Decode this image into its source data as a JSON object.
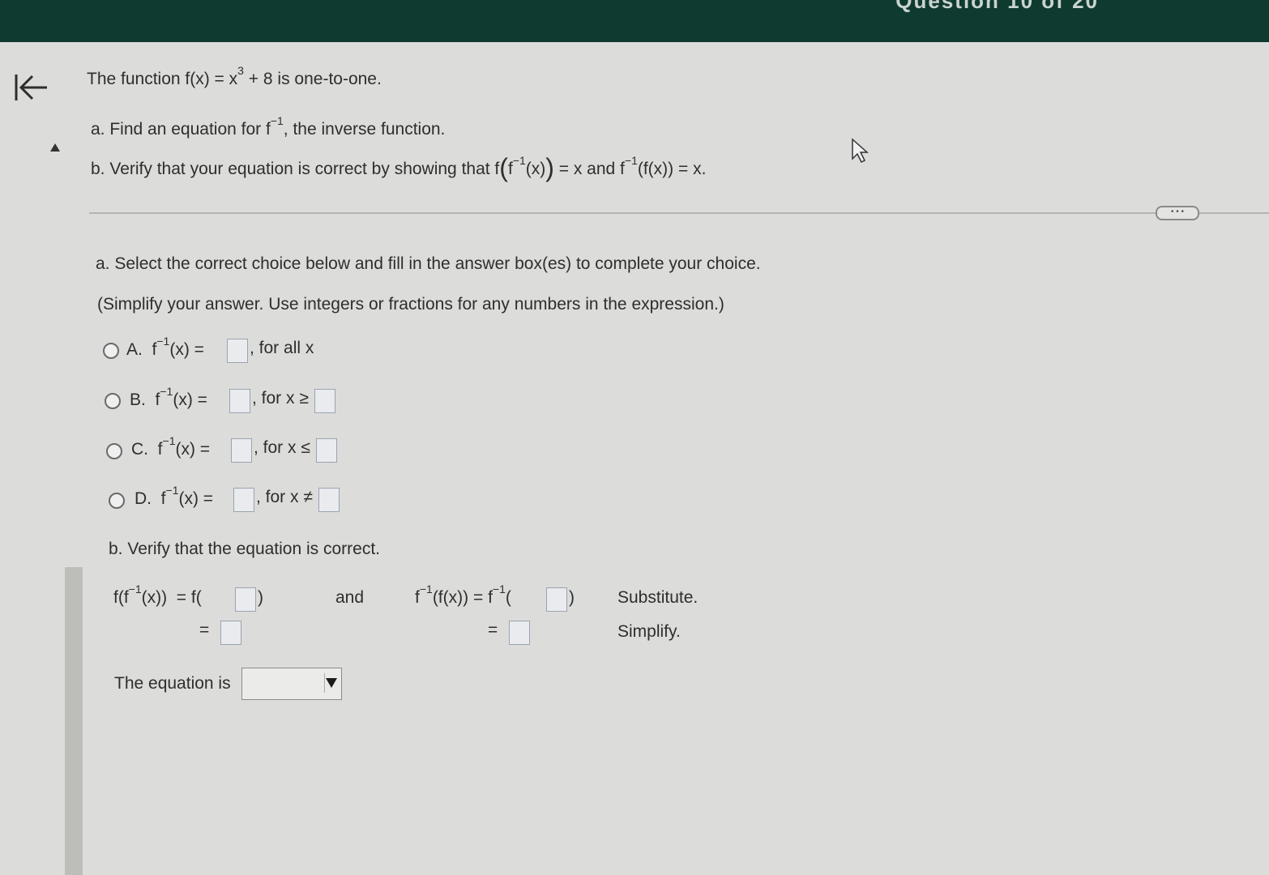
{
  "header": {
    "title": "Question 10 of 20"
  },
  "problem": {
    "intro": "The function f(x) = x",
    "intro_exp": "3",
    "intro_tail": " + 8 is one-to-one.",
    "part_a": "a. Find an equation for f",
    "part_a_exp": "−1",
    "part_a_tail": ", the inverse function.",
    "part_b_start": "b. Verify that your equation is correct by showing that f",
    "part_b_inner_f": "f",
    "part_b_exp1": "−1",
    "part_b_x": "(x)",
    "part_b_mid": " = x and f",
    "part_b_exp2": "−1",
    "part_b_end": "(f(x)) = x."
  },
  "more_button": "• • •",
  "part_a": {
    "instruction": "a. Select the correct choice below and fill in the answer box(es) to complete your choice.",
    "hint": "(Simplify your answer. Use integers or fractions for any numbers in the expression.)",
    "choices": [
      {
        "letter": "A.",
        "func": "f",
        "exp": "−1",
        "arg": "(x) =",
        "cond": ", for all x"
      },
      {
        "letter": "B.",
        "func": "f",
        "exp": "−1",
        "arg": "(x) =",
        "cond": ", for x ≥"
      },
      {
        "letter": "C.",
        "func": "f",
        "exp": "−1",
        "arg": "(x) =",
        "cond": ", for x ≤"
      },
      {
        "letter": "D.",
        "func": "f",
        "exp": "−1",
        "arg": "(x) =",
        "cond": ", for x ≠"
      }
    ]
  },
  "part_b": {
    "instruction": "b. Verify that the equation is correct.",
    "left_expr": "f(f",
    "left_exp": "−1",
    "left_tail": "(x))",
    "left_eq": "= f(",
    "left_close": ")",
    "eq_sign": "=",
    "and": "and",
    "right_f": "f",
    "right_exp": "−1",
    "right_arg": "(f(x))",
    "right_eq": "= f",
    "right_exp2": "−1",
    "right_open": "(",
    "right_close": ")",
    "substitute": "Substitute.",
    "simplify": "Simplify.",
    "equation_is": "The equation is"
  }
}
